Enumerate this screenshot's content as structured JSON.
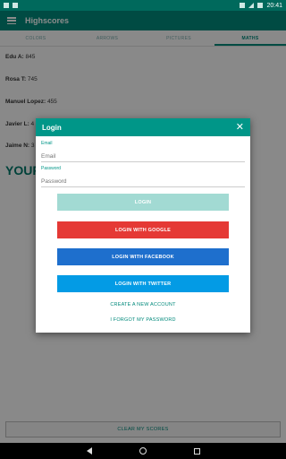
{
  "status_bar": {
    "time": "20:41"
  },
  "toolbar": {
    "title": "Highscores"
  },
  "tabs": [
    {
      "label": "COLORS"
    },
    {
      "label": "ARROWS"
    },
    {
      "label": "PICTURES"
    },
    {
      "label": "MATHS"
    }
  ],
  "scores": [
    {
      "name": "Edu A:",
      "score": " 845"
    },
    {
      "name": "Rosa T:",
      "score": " 745"
    },
    {
      "name": "Manuel Lopez:",
      "score": " 455"
    },
    {
      "name": "Javier L:",
      "score": " 4"
    },
    {
      "name": "Jaime N:",
      "score": " 3"
    }
  ],
  "your_score_label": "YOUR",
  "clear_button": "CLEAR MY SCORES",
  "dialog": {
    "title": "Login",
    "email_label": "Email",
    "email_placeholder": "Email",
    "password_label": "Password",
    "password_placeholder": "Password",
    "login_button": "LOGIN",
    "google_button": "LOGIN WITH GOOGLE",
    "facebook_button": "LOGIN WITH FACEBOOK",
    "twitter_button": "LOGIN WITH TWITTER",
    "create_account_link": "CREATE A NEW ACCOUNT",
    "forgot_password_link": "I FORGOT MY PASSWORD"
  }
}
